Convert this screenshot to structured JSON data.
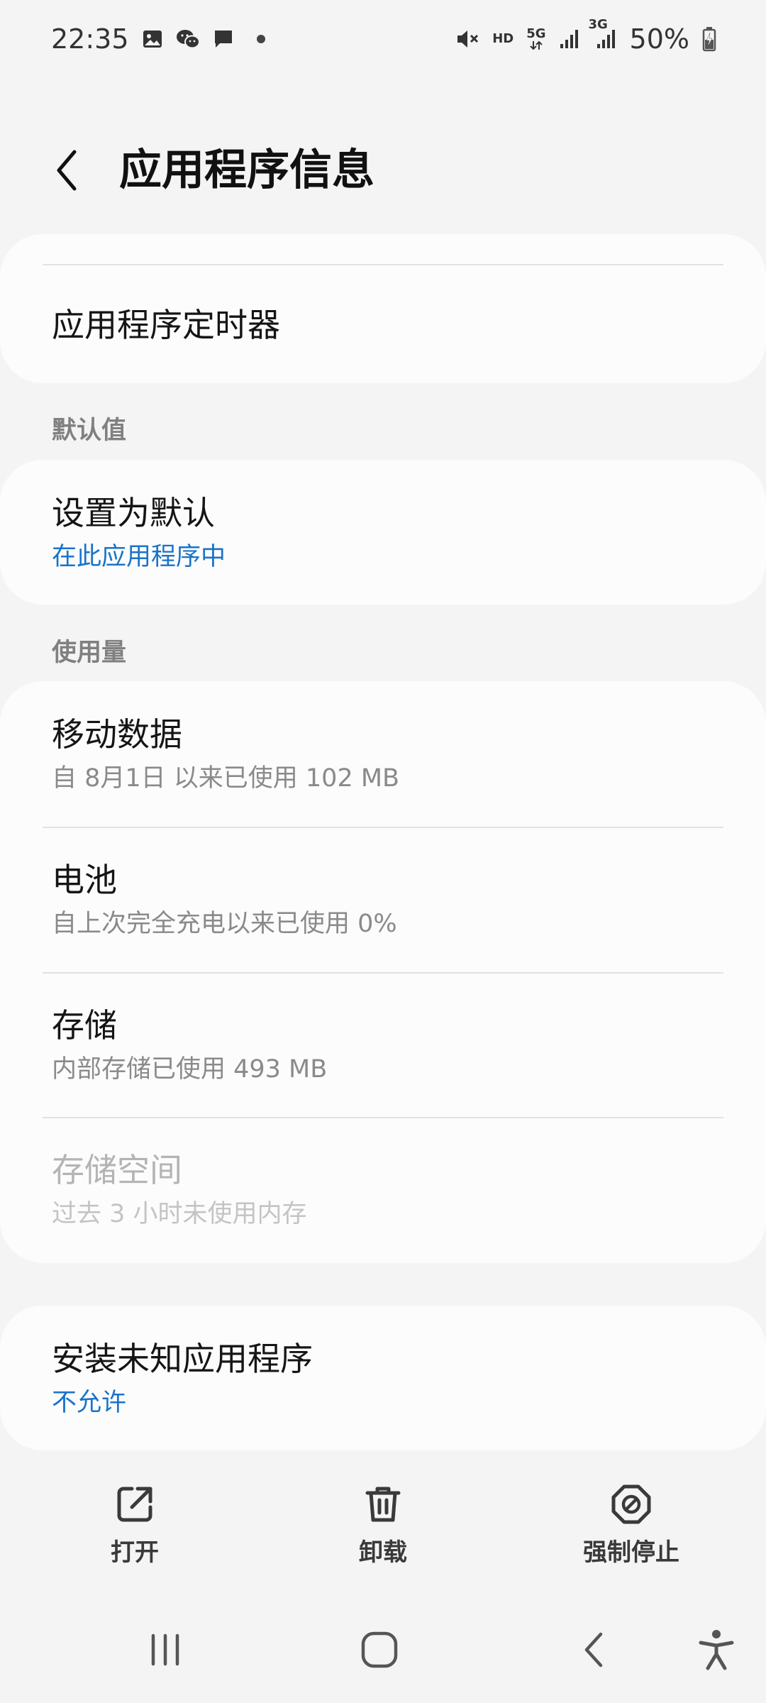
{
  "status_bar": {
    "time": "22:35",
    "left_icons": [
      "image-icon",
      "wechat-icon",
      "message-icon",
      "notification-dot-icon"
    ],
    "hd_label": "HD",
    "network_5g": "5G",
    "network_3g": "3G",
    "battery_percent": "50%"
  },
  "header": {
    "title": "应用程序信息"
  },
  "card_timer": {
    "title": "应用程序定时器"
  },
  "section_defaults": {
    "label": "默认值"
  },
  "card_defaults": {
    "title": "设置为默认",
    "subtitle": "在此应用程序中"
  },
  "section_usage": {
    "label": "使用量"
  },
  "usage": {
    "items": [
      {
        "title": "移动数据",
        "subtitle": "自 8月1日 以来已使用 102 MB"
      },
      {
        "title": "电池",
        "subtitle": "自上次完全充电以来已使用 0%"
      },
      {
        "title": "存储",
        "subtitle": "内部存储已使用 493 MB"
      },
      {
        "title": "存储空间",
        "subtitle": "过去 3 小时未使用内存"
      }
    ]
  },
  "card_install": {
    "title": "安装未知应用程序",
    "subtitle": "不允许"
  },
  "actions": {
    "open_label": "打开",
    "uninstall_label": "卸载",
    "force_stop_label": "强制停止"
  },
  "colors": {
    "background": "#f4f4f4",
    "card": "#fcfcfc",
    "link": "#1a73c8",
    "secondary_text": "#8a8a8a"
  }
}
